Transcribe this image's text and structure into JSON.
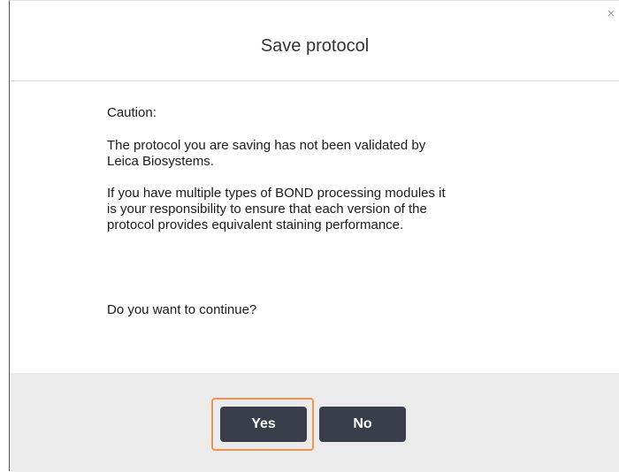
{
  "dialog": {
    "title": "Save protocol",
    "close_glyph": "×",
    "caution_label": "Caution:",
    "paragraph1": "The protocol you are saving has not been validated by\nLeica Biosystems.",
    "paragraph2": "If you have multiple types of BOND processing modules it\nis your responsibility to ensure that each version of the\nprotocol provides equivalent staining performance.",
    "question": "Do you want to continue?"
  },
  "buttons": {
    "yes_label": "Yes",
    "no_label": "No"
  },
  "colors": {
    "button_bg": "#3a3d4a",
    "focus_ring": "#f0954f",
    "footer_bg": "#ebebeb"
  },
  "icons": {
    "close": "close-icon"
  }
}
